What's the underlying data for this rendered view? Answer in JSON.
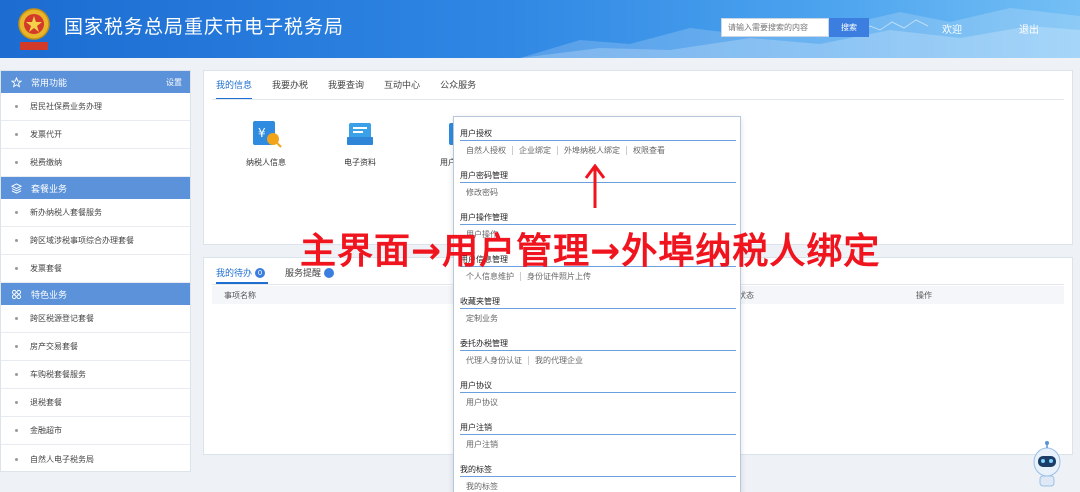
{
  "header": {
    "title": "国家税务总局重庆市电子税务局",
    "search_placeholder": "请输入需要搜索的内容",
    "search_button": "搜索",
    "welcome": "欢迎",
    "logout": "退出"
  },
  "sidebar": {
    "sections": [
      {
        "title": "常用功能",
        "icon": "star-icon",
        "settings": "设置",
        "items": [
          "居民社保费业务办理",
          "发票代开",
          "税费缴纳"
        ]
      },
      {
        "title": "套餐业务",
        "icon": "package-icon",
        "items": [
          "新办纳税人套餐服务",
          "跨区域涉税事项综合办理套餐",
          "发票套餐"
        ]
      },
      {
        "title": "特色业务",
        "icon": "grid-icon",
        "items": [
          "跨区税源登记套餐",
          "房产交易套餐",
          "车购税套餐服务",
          "退税套餐",
          "金融超市",
          "自然人电子税务局"
        ]
      }
    ]
  },
  "main": {
    "tabs": [
      "我的信息",
      "我要办税",
      "我要查询",
      "互动中心",
      "公众服务"
    ],
    "quick_items": [
      {
        "label": "纳税人信息",
        "icon": "taxpayer-info-icon"
      },
      {
        "label": "电子资料",
        "icon": "electronic-docs-icon"
      },
      {
        "label": "用户管",
        "icon": "user-management-icon"
      }
    ],
    "todo_tab": "我的待办",
    "todo_count": "0",
    "service_tab": "服务提醒",
    "table_headers": [
      "事项名称",
      "状态",
      "操作"
    ]
  },
  "dropdown": {
    "groups": [
      {
        "title": "用户授权",
        "items": [
          "自然人授权",
          "企业绑定",
          "外埠纳税人绑定",
          "权限查看"
        ]
      },
      {
        "title": "用户密码管理",
        "items": [
          "修改密码"
        ]
      },
      {
        "title": "用户操作管理",
        "items": [
          "用户操作"
        ]
      },
      {
        "title": "用户信息管理",
        "items": [
          "个人信息维护",
          "身份证件照片上传"
        ]
      },
      {
        "title": "收藏夹管理",
        "items": [
          "定制业务"
        ]
      },
      {
        "title": "委托办税管理",
        "items": [
          "代理人身份认证",
          "我的代理企业"
        ]
      },
      {
        "title": "用户协议",
        "items": [
          "用户协议"
        ]
      },
      {
        "title": "用户注销",
        "items": [
          "用户注销"
        ]
      },
      {
        "title": "我的标签",
        "items": [
          "我的标签"
        ]
      }
    ]
  },
  "annotation": "主界面→用户管理→外埠纳税人绑定",
  "colors": {
    "header_blue": "#2f86e3",
    "sidebar_head": "#5b92d9",
    "active_tab": "#1f6fd1",
    "annotation_red": "#f0141e"
  }
}
